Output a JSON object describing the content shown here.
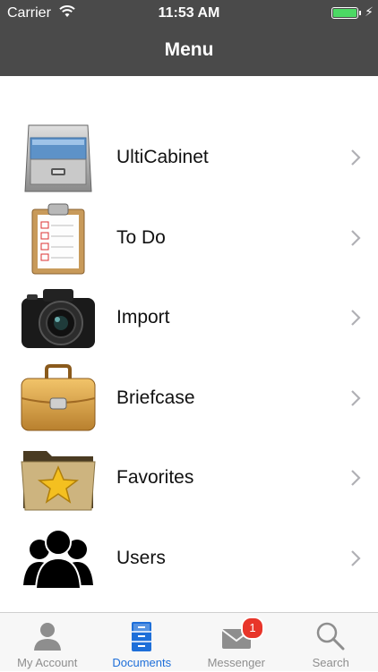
{
  "status": {
    "carrier": "Carrier",
    "time": "11:53 AM",
    "battery_level": 1.0,
    "battery_color": "#4cd964"
  },
  "nav": {
    "title": "Menu",
    "background": "#4a4a4a"
  },
  "menu": {
    "items": [
      {
        "label": "UltiCabinet",
        "icon": "file-cabinet-icon"
      },
      {
        "label": "To Do",
        "icon": "clipboard-icon"
      },
      {
        "label": "Import",
        "icon": "camera-icon"
      },
      {
        "label": "Briefcase",
        "icon": "briefcase-icon"
      },
      {
        "label": "Favorites",
        "icon": "star-folder-icon"
      },
      {
        "label": "Users",
        "icon": "users-icon"
      }
    ]
  },
  "tabs": {
    "active_color": "#1e6fd9",
    "items": [
      {
        "label": "My Account",
        "icon": "person-icon"
      },
      {
        "label": "Documents",
        "icon": "cabinet-tab-icon",
        "active": true
      },
      {
        "label": "Messenger",
        "icon": "envelope-icon",
        "badge": "1"
      },
      {
        "label": "Search",
        "icon": "magnifier-icon"
      }
    ]
  }
}
